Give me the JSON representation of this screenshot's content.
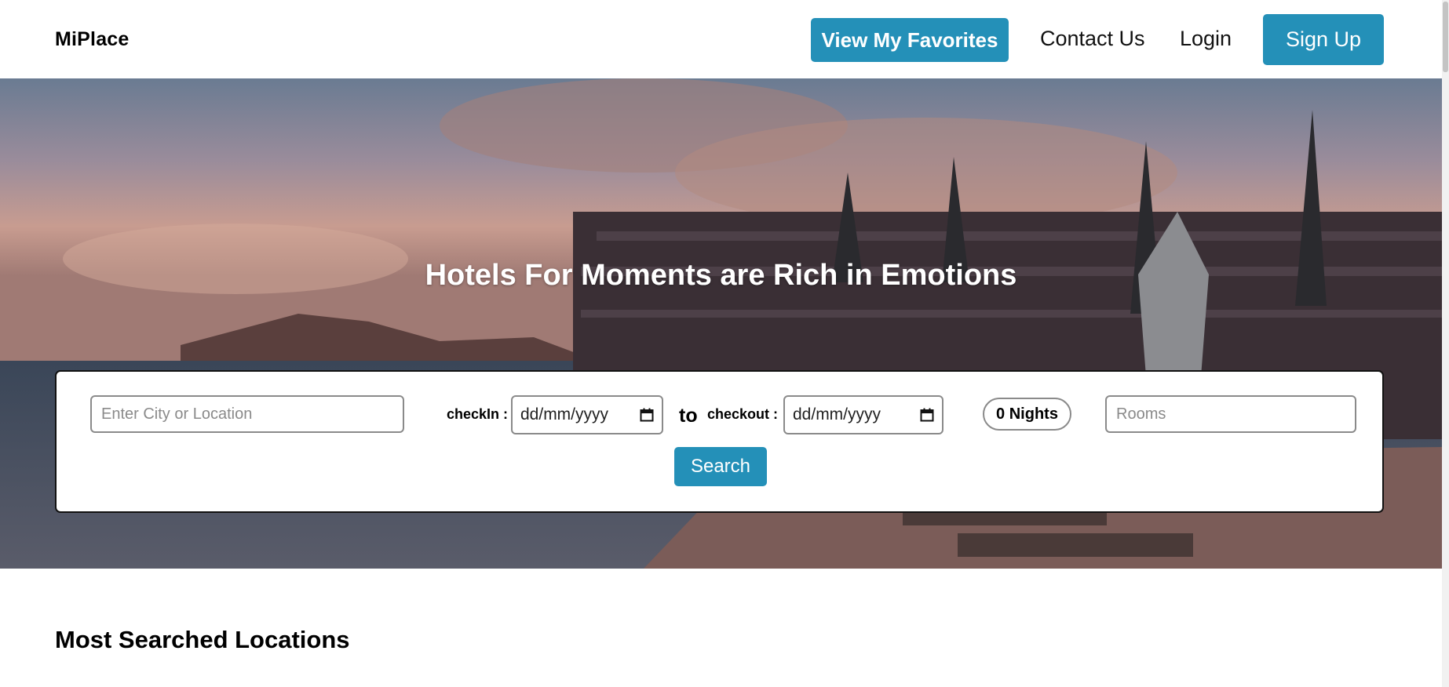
{
  "navbar": {
    "brand": "MiPlace",
    "favorites_label": "View My Favorites",
    "contact_label": "Contact Us",
    "login_label": "Login",
    "signup_label": "Sign Up"
  },
  "hero": {
    "title": "Hotels For Moments are Rich in Emotions"
  },
  "search": {
    "city_placeholder": "Enter City or Location",
    "checkin_label": "checkIn :",
    "checkin_value": "dd/mm/yyyy",
    "to_label": "to",
    "checkout_label": "checkout :",
    "checkout_value": "dd/mm/yyyy",
    "nights": "0 Nights",
    "rooms_placeholder": "Rooms",
    "search_label": "Search"
  },
  "sections": {
    "most_searched_title": "Most Searched Locations"
  },
  "colors": {
    "accent": "#2490b8"
  }
}
